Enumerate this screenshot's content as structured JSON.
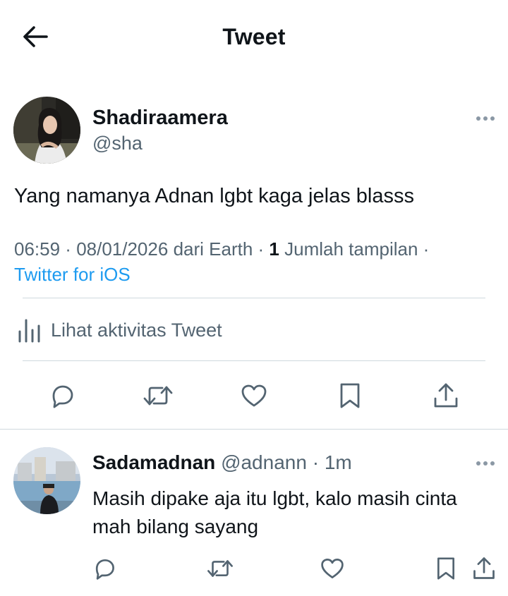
{
  "header": {
    "title": "Tweet"
  },
  "tweet": {
    "author_name": "Shadiraamera",
    "author_handle": "@sha",
    "text": "Yang namanya Adnan lgbt kaga jelas blasss",
    "time": "06:59",
    "date": "08/01/2026",
    "location_prefix": "dari",
    "location": "Earth",
    "views_count": "1",
    "views_label": "Jumlah tampilan",
    "source": "Twitter for iOS",
    "activity_label": "Lihat aktivitas Tweet"
  },
  "reply": {
    "author_name": "Sadamadnan",
    "author_handle": "@adnann",
    "time": "1m",
    "text": "Masih dipake aja itu lgbt, kalo masih cinta mah bilang sayang"
  },
  "icons": {
    "back": "arrow-left-icon",
    "more": "more-horizontal-icon",
    "analytics": "bar-chart-icon",
    "reply": "reply-icon",
    "retweet": "retweet-icon",
    "like": "heart-icon",
    "bookmark": "bookmark-icon",
    "share": "share-icon"
  },
  "colors": {
    "accent": "#1d9bf0",
    "secondary_text": "#536471",
    "divider": "#cfd9de",
    "icon": "#536471"
  }
}
